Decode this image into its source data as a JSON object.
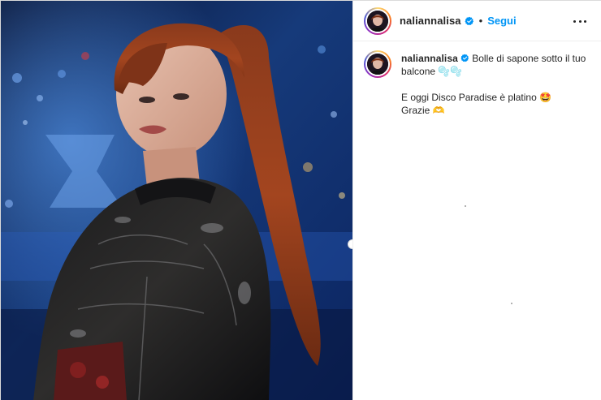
{
  "post": {
    "username": "naliannalisa",
    "separator": "•",
    "follow_label": "Segui",
    "more_icon": "more-horizontal-icon"
  },
  "caption": {
    "username": "naliannalisa",
    "line1": "Bolle di sapone sotto il tuo balcone 🫧🫧",
    "line2": "E oggi Disco Paradise è platino 🤩",
    "line3": "Grazie 🫶"
  },
  "colors": {
    "accent": "#0095f6",
    "verified": "#0095f6",
    "text": "#262626",
    "border": "#dbdbdb"
  }
}
